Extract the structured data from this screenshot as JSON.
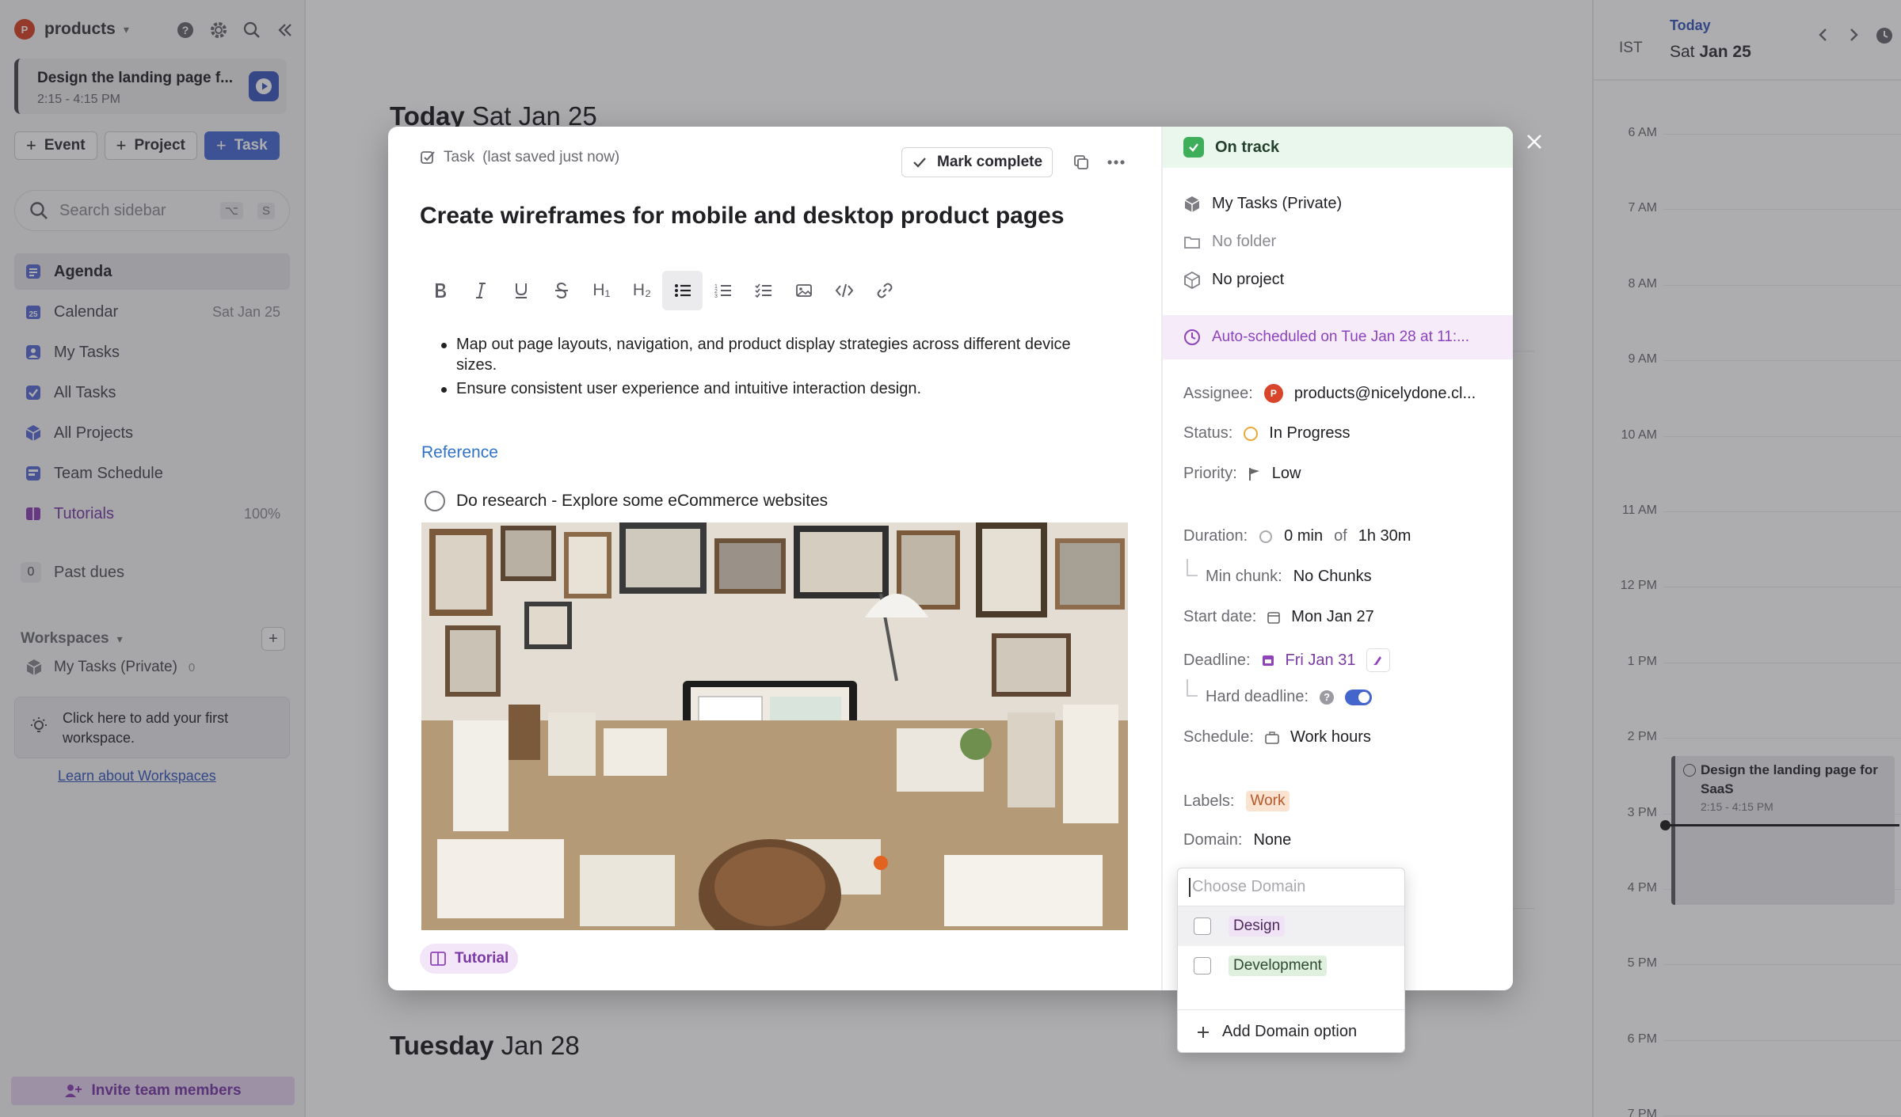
{
  "sidebar": {
    "workspace_initial": "P",
    "workspace_name": "products",
    "current_event": {
      "title": "Design the landing page f...",
      "time": "2:15 - 4:15 PM"
    },
    "buttons": {
      "event": "Event",
      "project": "Project",
      "task": "Task"
    },
    "search": {
      "placeholder": "Search sidebar",
      "kbd1": "⌥",
      "kbd2": "S"
    },
    "nav": [
      {
        "label": "Agenda",
        "meta": ""
      },
      {
        "label": "Calendar",
        "meta": "Sat Jan 25"
      },
      {
        "label": "My Tasks",
        "meta": ""
      },
      {
        "label": "All Tasks",
        "meta": ""
      },
      {
        "label": "All Projects",
        "meta": ""
      },
      {
        "label": "Team Schedule",
        "meta": ""
      },
      {
        "label": "Tutorials",
        "meta": "100%"
      }
    ],
    "past_dues": {
      "count": "0",
      "label": "Past dues"
    },
    "workspaces": {
      "heading": "Workspaces",
      "item": {
        "label": "My Tasks (Private)",
        "count": "0"
      },
      "hint": "Click here to add your first workspace.",
      "learn": "Learn about Workspaces"
    },
    "invite": "Invite team members"
  },
  "main": {
    "today_head": {
      "bold": "Today",
      "rest": "Sat Jan 25"
    },
    "tuesday_head": {
      "bold": "Tuesday",
      "rest": "Jan 28"
    }
  },
  "calendar": {
    "tz": "IST",
    "today": "Today",
    "date_pre": "Sat",
    "date_bold": "Jan 25",
    "hours": [
      "6 AM",
      "7 AM",
      "8 AM",
      "9 AM",
      "10 AM",
      "11 AM",
      "12 PM",
      "1 PM",
      "2 PM",
      "3 PM",
      "4 PM",
      "5 PM",
      "6 PM",
      "7 PM"
    ],
    "event": {
      "title": "Design the landing page for SaaS",
      "time": "2:15 - 4:15 PM"
    }
  },
  "modal": {
    "kind": "Task",
    "saved": "(last saved just now)",
    "mark_complete": "Mark complete",
    "title": "Create wireframes for mobile and desktop product pages",
    "bullets": [
      "Map out page layouts, navigation, and product display strategies across different device sizes.",
      "Ensure consistent user experience and intuitive interaction design."
    ],
    "reference": "Reference",
    "check_item": "Do research - Explore some eCommerce websites",
    "tag": "Tutorial",
    "toolbar": {
      "h1": "H₁",
      "h2": "H₂"
    }
  },
  "details": {
    "status_banner": "On track",
    "workspace": "My Tasks (Private)",
    "folder": "No folder",
    "project": "No project",
    "auto_scheduled": "Auto-scheduled on Tue Jan 28 at 11:...",
    "assignee_label": "Assignee:",
    "assignee_initial": "P",
    "assignee": "products@nicelydone.cl...",
    "status_label": "Status:",
    "status": "In Progress",
    "priority_label": "Priority:",
    "priority": "Low",
    "duration_label": "Duration:",
    "duration_done": "0 min",
    "duration_of": "of",
    "duration_total": "1h 30m",
    "min_chunk_label": "Min chunk:",
    "min_chunk": "No Chunks",
    "start_label": "Start date:",
    "start": "Mon Jan 27",
    "deadline_label": "Deadline:",
    "deadline": "Fri Jan 31",
    "hard_deadline_label": "Hard deadline:",
    "hard_deadline_help": "?",
    "schedule_label": "Schedule:",
    "schedule": "Work hours",
    "labels_label": "Labels:",
    "label_work": "Work",
    "domain_label": "Domain:",
    "domain": "None"
  },
  "domain_dropdown": {
    "placeholder": "Choose Domain",
    "options": [
      "Design",
      "Development"
    ],
    "add": "Add Domain option"
  }
}
